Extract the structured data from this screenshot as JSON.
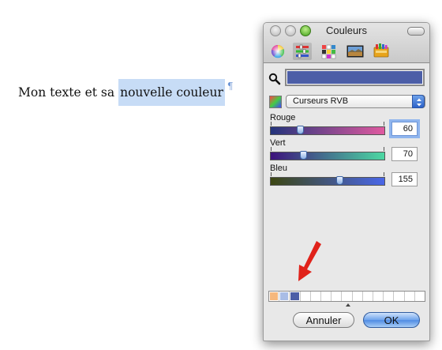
{
  "document": {
    "plain_text": "Mon texte et sa",
    "selected_text": "nouvelle couleur",
    "pilcrow": "¶"
  },
  "window": {
    "title": "Couleurs",
    "toolbar": [
      {
        "name": "color-wheel-icon"
      },
      {
        "name": "color-sliders-icon",
        "selected": true
      },
      {
        "name": "color-palettes-icon"
      },
      {
        "name": "image-palettes-icon"
      },
      {
        "name": "crayons-icon"
      }
    ],
    "current_color": "#4c5ea7",
    "mode_popup": "Curseurs RVB",
    "sliders": [
      {
        "label": "Rouge",
        "value": "60",
        "level": 0.24
      },
      {
        "label": "Vert",
        "value": "70",
        "level": 0.27
      },
      {
        "label": "Bleu",
        "value": "155",
        "level": 0.61
      }
    ],
    "swatches": [
      "#f6b87c",
      "#a9bde6",
      "#4c5ea7"
    ],
    "cancel_label": "Annuler",
    "ok_label": "OK"
  },
  "annotation": {
    "arrow_color": "#e0221a"
  }
}
